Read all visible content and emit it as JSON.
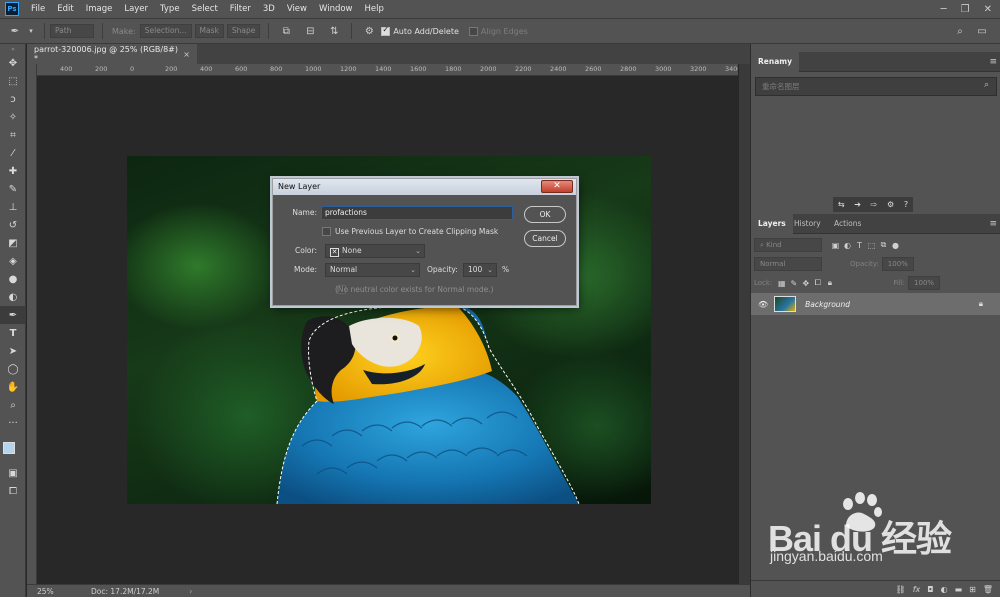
{
  "app": {
    "logo": "Ps"
  },
  "menu": [
    "File",
    "Edit",
    "Image",
    "Layer",
    "Type",
    "Select",
    "Filter",
    "3D",
    "View",
    "Window",
    "Help"
  ],
  "options": {
    "path_mode": "Path",
    "make_label": "Make:",
    "selection_btn": "Selection...",
    "mask_btn": "Mask",
    "shape_btn": "Shape",
    "auto_add_delete": "Auto Add/Delete",
    "align_edges": "Align Edges"
  },
  "document": {
    "tab_title": "parrot-320006.jpg @ 25% (RGB/8#) *",
    "ruler_ticks": [
      "400",
      "200",
      "0",
      "200",
      "400",
      "600",
      "800",
      "1000",
      "1200",
      "1400",
      "1600",
      "1800",
      "2000",
      "2200",
      "2400",
      "2600",
      "2800",
      "3000",
      "3200",
      "3400"
    ],
    "zoom": "25%",
    "doc_size": "Doc: 17.2M/17.2M"
  },
  "renamy": {
    "title": "Renamy",
    "placeholder": "重命名图层"
  },
  "layers_panel": {
    "tabs": [
      "Layers",
      "History",
      "Actions"
    ],
    "kind_label": "Kind",
    "blend_mode": "Normal",
    "opacity_label": "Opacity:",
    "opacity_value": "100%",
    "lock_label": "Lock:",
    "fill_label": "Fill:",
    "fill_value": "100%",
    "layer_name": "Background",
    "bottom_icons": [
      "link-icon",
      "fx-icon",
      "mask-icon",
      "adjustment-icon",
      "folder-icon",
      "new-layer-icon",
      "trash-icon"
    ]
  },
  "dialog": {
    "title": "New Layer",
    "name_label": "Name:",
    "name_value": "profactions",
    "clip_label": "Use Previous Layer to Create Clipping Mask",
    "color_label": "Color:",
    "color_value": "None",
    "mode_label": "Mode:",
    "mode_value": "Normal",
    "opacity_label": "Opacity:",
    "opacity_value": "100",
    "opacity_unit": "%",
    "neutral_label": "(No neutral color exists for Normal mode.)",
    "ok": "OK",
    "cancel": "Cancel",
    "close": "✕"
  },
  "watermark": {
    "brand": "Bai du 经验",
    "url": "jingyan.baidu.com"
  },
  "colors": {
    "accent": "#31a8ff",
    "panel": "#535353",
    "workspace": "#282828",
    "selected_layer": "#6d6d6d"
  }
}
